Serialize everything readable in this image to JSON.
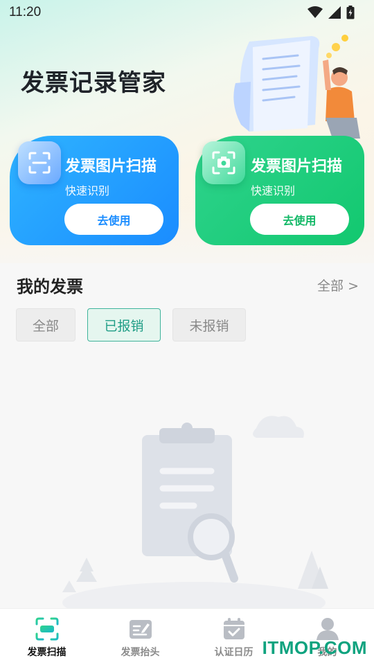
{
  "status_bar": {
    "time": "11:20"
  },
  "page_title": "发票记录管家",
  "cards": [
    {
      "title": "发票图片扫描",
      "subtitle": "快速识别",
      "button": "去使用",
      "icon": "scan-frame-icon",
      "color": "#1a8cff"
    },
    {
      "title": "发票图片扫描",
      "subtitle": "快速识别",
      "button": "去使用",
      "icon": "camera-icon",
      "color": "#12c86f"
    }
  ],
  "section": {
    "title": "我的发票",
    "see_all": "全部 >"
  },
  "filters": [
    {
      "label": "全部",
      "active": false
    },
    {
      "label": "已报销",
      "active": true
    },
    {
      "label": "未报销",
      "active": false
    }
  ],
  "bottom_nav": [
    {
      "label": "发票扫描",
      "icon": "scan-icon",
      "active": true
    },
    {
      "label": "发票抬头",
      "icon": "edit-doc-icon",
      "active": false
    },
    {
      "label": "认证日历",
      "icon": "calendar-icon",
      "active": false
    },
    {
      "label": "我的",
      "icon": "user-icon",
      "active": false
    }
  ],
  "watermark": "ITMOP.COM",
  "colors": {
    "accent_teal": "#1f9d86",
    "blue": "#1a8cff",
    "green": "#12c86f"
  }
}
